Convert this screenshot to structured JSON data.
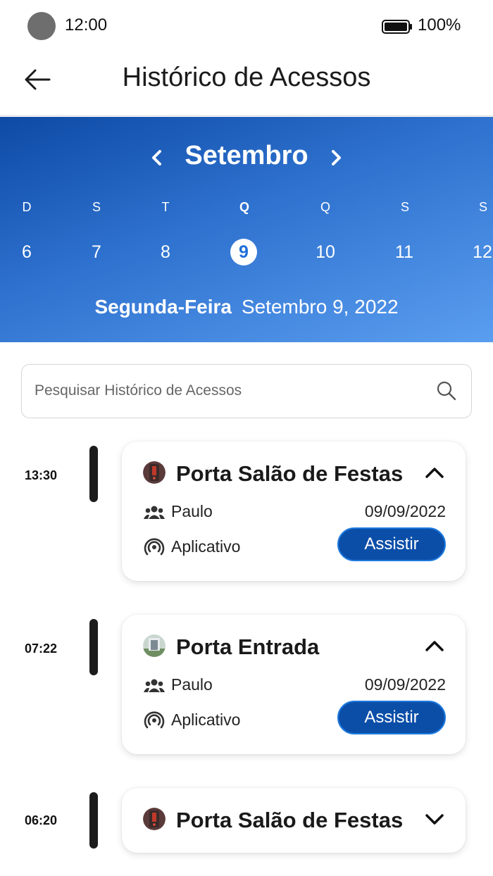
{
  "status_bar": {
    "time": "12:00",
    "battery": "100%"
  },
  "header": {
    "title": "Histórico de Acessos"
  },
  "calendar": {
    "month": "Setembro",
    "weekdays": [
      "D",
      "S",
      "T",
      "Q",
      "Q",
      "S",
      "S"
    ],
    "days": [
      "6",
      "7",
      "8",
      "9",
      "10",
      "11",
      "12"
    ],
    "selected_index": 3,
    "selected_weekday": "Segunda-Feira",
    "selected_date": "Setembro 9, 2022"
  },
  "search": {
    "placeholder": "Pesquisar Histórico de Acessos"
  },
  "entries": [
    {
      "time": "13:30",
      "title": "Porta Salão de Festas",
      "person": "Paulo",
      "date": "09/09/2022",
      "source": "Aplicativo",
      "button": "Assistir",
      "expanded": true,
      "icon": "door-red-icon"
    },
    {
      "time": "07:22",
      "title": "Porta Entrada",
      "person": "Paulo",
      "date": "09/09/2022",
      "source": "Aplicativo",
      "button": "Assistir",
      "expanded": true,
      "icon": "door-photo-icon"
    },
    {
      "time": "06:20",
      "title": "Porta Salão de Festas",
      "expanded": false,
      "icon": "door-red-icon"
    }
  ],
  "colors": {
    "accent": "#0b4ea8",
    "banner_start": "#0d4aa6",
    "banner_end": "#5a9ef0"
  }
}
